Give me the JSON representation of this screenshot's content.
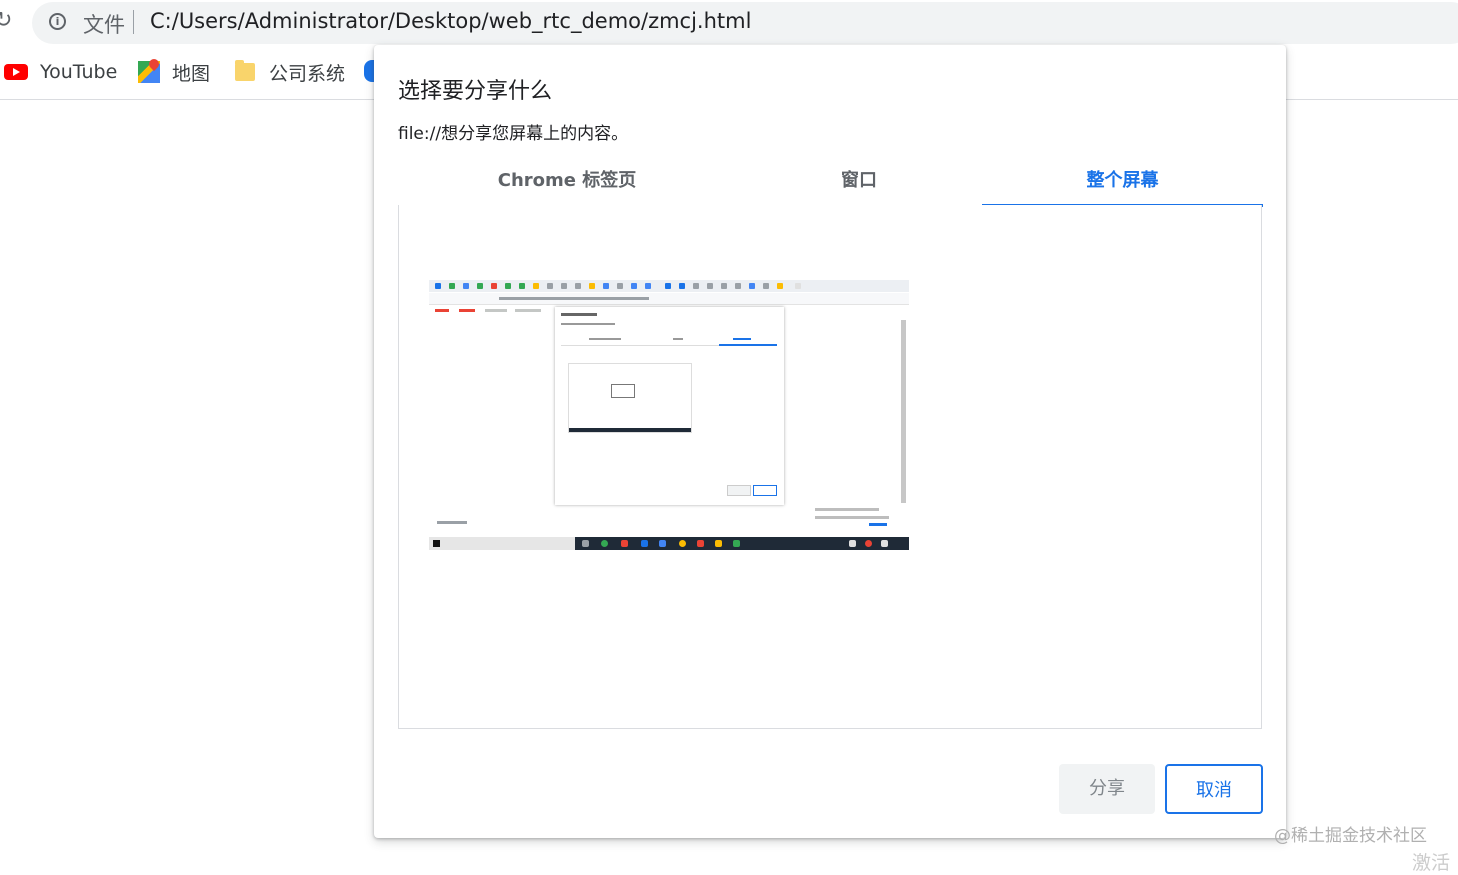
{
  "browser": {
    "reload_icon": "reload-icon",
    "info_icon": "info-circle-icon",
    "info_glyph": "i",
    "file_label": "文件",
    "url": "C:/Users/Administrator/Desktop/web_rtc_demo/zmcj.html",
    "bookmarks": [
      {
        "label": "YouTube",
        "icon": "youtube-icon"
      },
      {
        "label": "地图",
        "icon": "maps-icon"
      },
      {
        "label": "公司系统",
        "icon": "folder-icon"
      }
    ]
  },
  "dialog": {
    "title": "选择要分享什么",
    "subtitle": "file://想分享您屏幕上的内容。",
    "tabs": [
      {
        "label": "Chrome 标签页",
        "active": false
      },
      {
        "label": "窗口",
        "active": false
      },
      {
        "label": "整个屏幕",
        "active": true
      }
    ],
    "share_label": "分享",
    "cancel_label": "取消"
  },
  "watermark": "@稀土掘金技术社区",
  "corner_text": "激活",
  "colors": {
    "accent": "#1a73e8",
    "youtube": "#ff0000",
    "omnibox_bg": "#f1f3f4",
    "disabled_text": "#80868b"
  }
}
